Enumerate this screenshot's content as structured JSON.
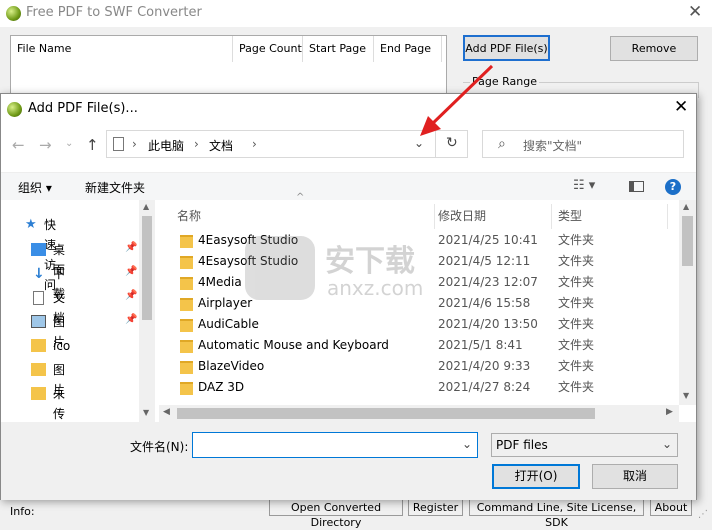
{
  "main": {
    "title": "Free PDF to SWF Converter",
    "columns": [
      "File Name",
      "Page Count",
      "Start Page",
      "End Page"
    ],
    "add_label": "Add PDF File(s)",
    "remove_label": "Remove",
    "page_range_label": "Page Range",
    "info_label": "Info:",
    "status_buttons": [
      "Open Converted Directory",
      "Register",
      "Command Line, Site License, SDK",
      "About"
    ]
  },
  "dialog": {
    "title": "Add PDF File(s)...",
    "breadcrumb": [
      "此电脑",
      "文档"
    ],
    "search_placeholder": "搜索\"文档\"",
    "toolbar": {
      "organize": "组织 ▾",
      "new_folder": "新建文件夹"
    },
    "nav": {
      "quick_access": "快速访问",
      "items": [
        "桌面",
        "下载",
        "文档",
        "图片",
        "ico",
        "图片",
        "未传",
        "文本"
      ]
    },
    "columns": {
      "name": "名称",
      "date": "修改日期",
      "type": "类型"
    },
    "files": [
      {
        "name": "4Easysoft Studio",
        "date": "2021/4/25 10:41",
        "type": "文件夹"
      },
      {
        "name": "4Esaysoft Studio",
        "date": "2021/4/5 12:11",
        "type": "文件夹"
      },
      {
        "name": "4Media",
        "date": "2021/4/23 12:07",
        "type": "文件夹"
      },
      {
        "name": "Airplayer",
        "date": "2021/4/6 15:58",
        "type": "文件夹"
      },
      {
        "name": "AudiCable",
        "date": "2021/4/20 13:50",
        "type": "文件夹"
      },
      {
        "name": "Automatic Mouse and Keyboard",
        "date": "2021/5/1 8:41",
        "type": "文件夹"
      },
      {
        "name": "BlazeVideo",
        "date": "2021/4/20 9:33",
        "type": "文件夹"
      },
      {
        "name": "DAZ 3D",
        "date": "2021/4/27 8:24",
        "type": "文件夹"
      }
    ],
    "filename_label": "文件名(N):",
    "filename_value": "",
    "filetype": "PDF files",
    "open_label": "打开(O)",
    "cancel_label": "取消"
  },
  "watermark": {
    "text": "安下载",
    "sub": "anxz.com"
  },
  "colors": {
    "accent": "#0078d7",
    "arrow": "#e02020",
    "folder": "#f4c44a"
  }
}
